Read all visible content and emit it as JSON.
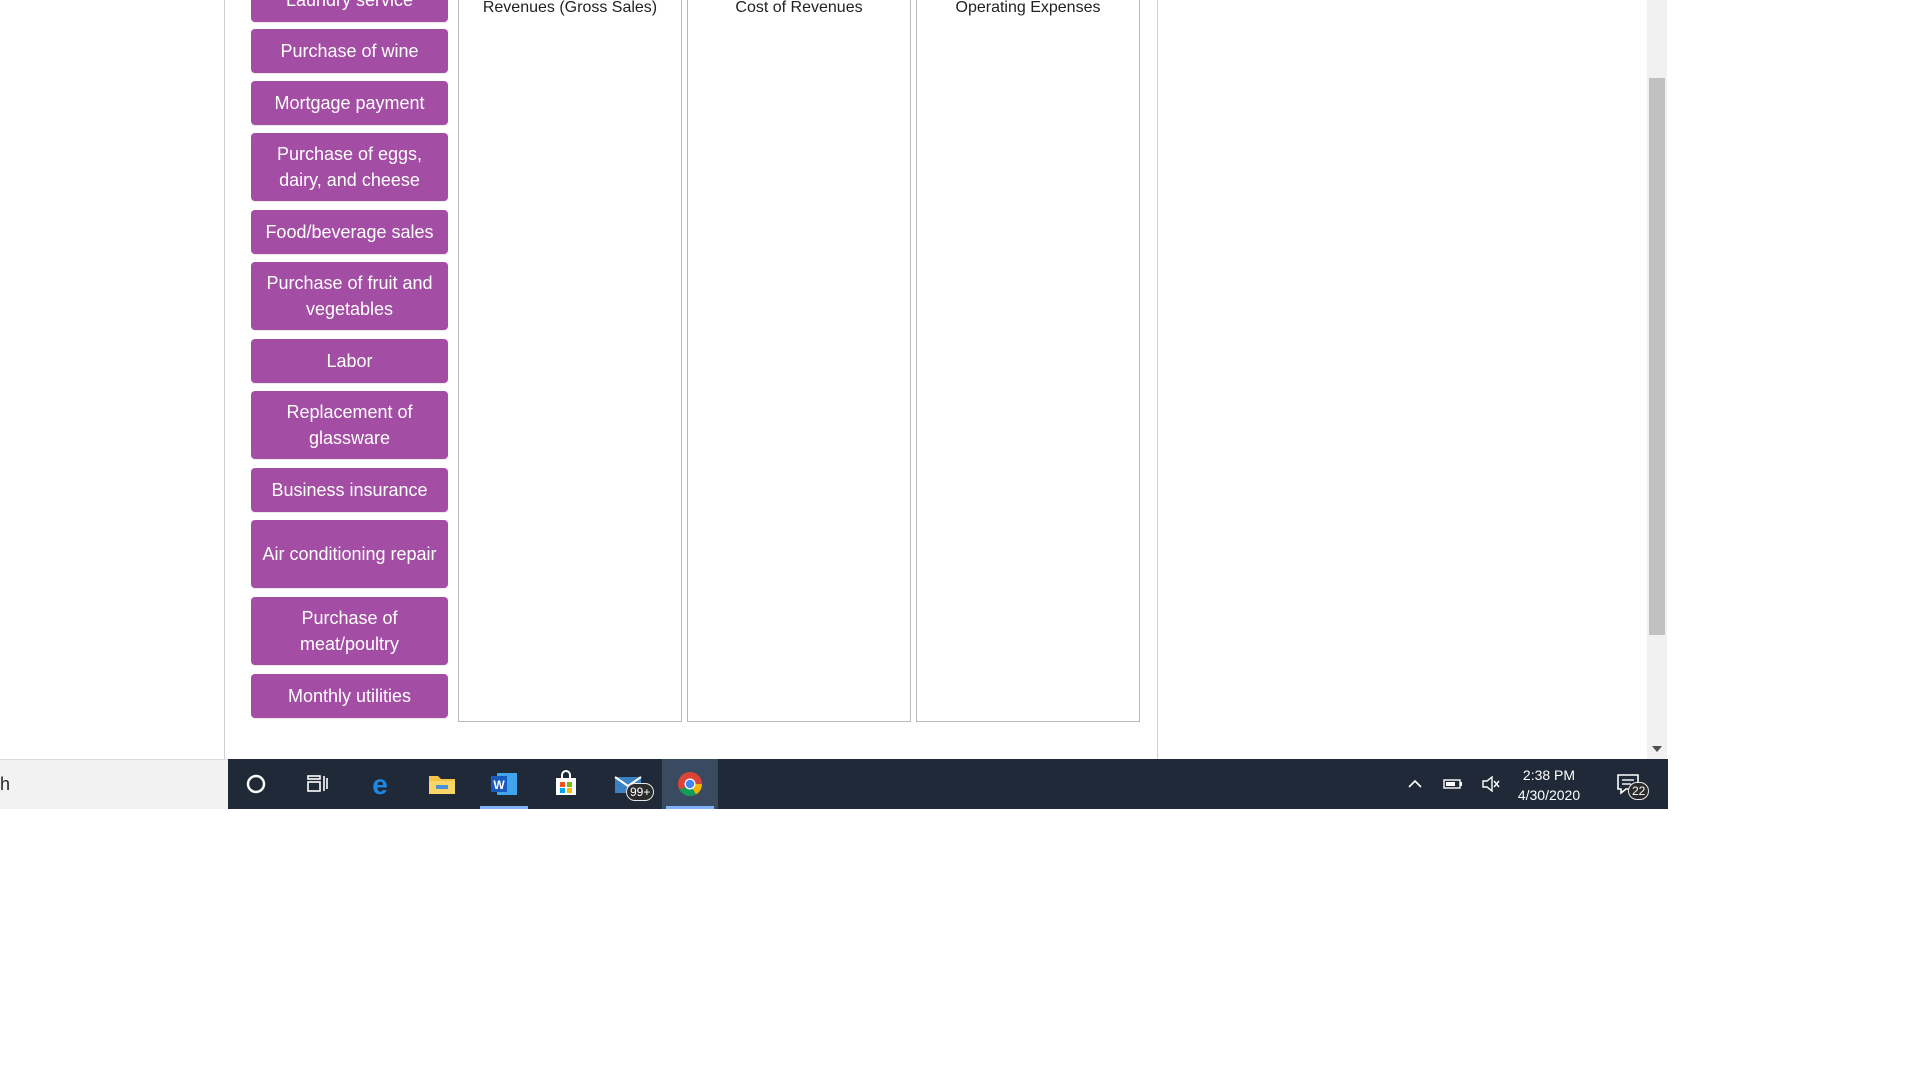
{
  "items": [
    {
      "label": "Laundry service"
    },
    {
      "label": "Purchase of wine"
    },
    {
      "label": "Mortgage payment"
    },
    {
      "label": "Purchase of eggs, dairy, and cheese"
    },
    {
      "label": "Food/beverage sales"
    },
    {
      "label": "Purchase of fruit and vegetables"
    },
    {
      "label": "Labor"
    },
    {
      "label": "Replacement of glassware"
    },
    {
      "label": "Business insurance"
    },
    {
      "label": "Air conditioning repair"
    },
    {
      "label": "Purchase of meat/poultry"
    },
    {
      "label": "Monthly utilities"
    }
  ],
  "bins": [
    {
      "title": "Revenues (Gross Sales)"
    },
    {
      "title": "Cost of Revenues"
    },
    {
      "title": "Operating Expenses"
    }
  ],
  "taskbar": {
    "search_text": "h",
    "mail_badge": "99+",
    "time": "2:38 PM",
    "date": "4/30/2020",
    "notifications_badge": "22",
    "icons": [
      "cortana-icon",
      "task-view-icon",
      "edge-icon",
      "file-explorer-icon",
      "word-icon",
      "store-icon",
      "mail-icon",
      "chrome-icon"
    ]
  },
  "colors": {
    "item_bg": "#a34ea4",
    "taskbar_bg": "#1f2937"
  }
}
